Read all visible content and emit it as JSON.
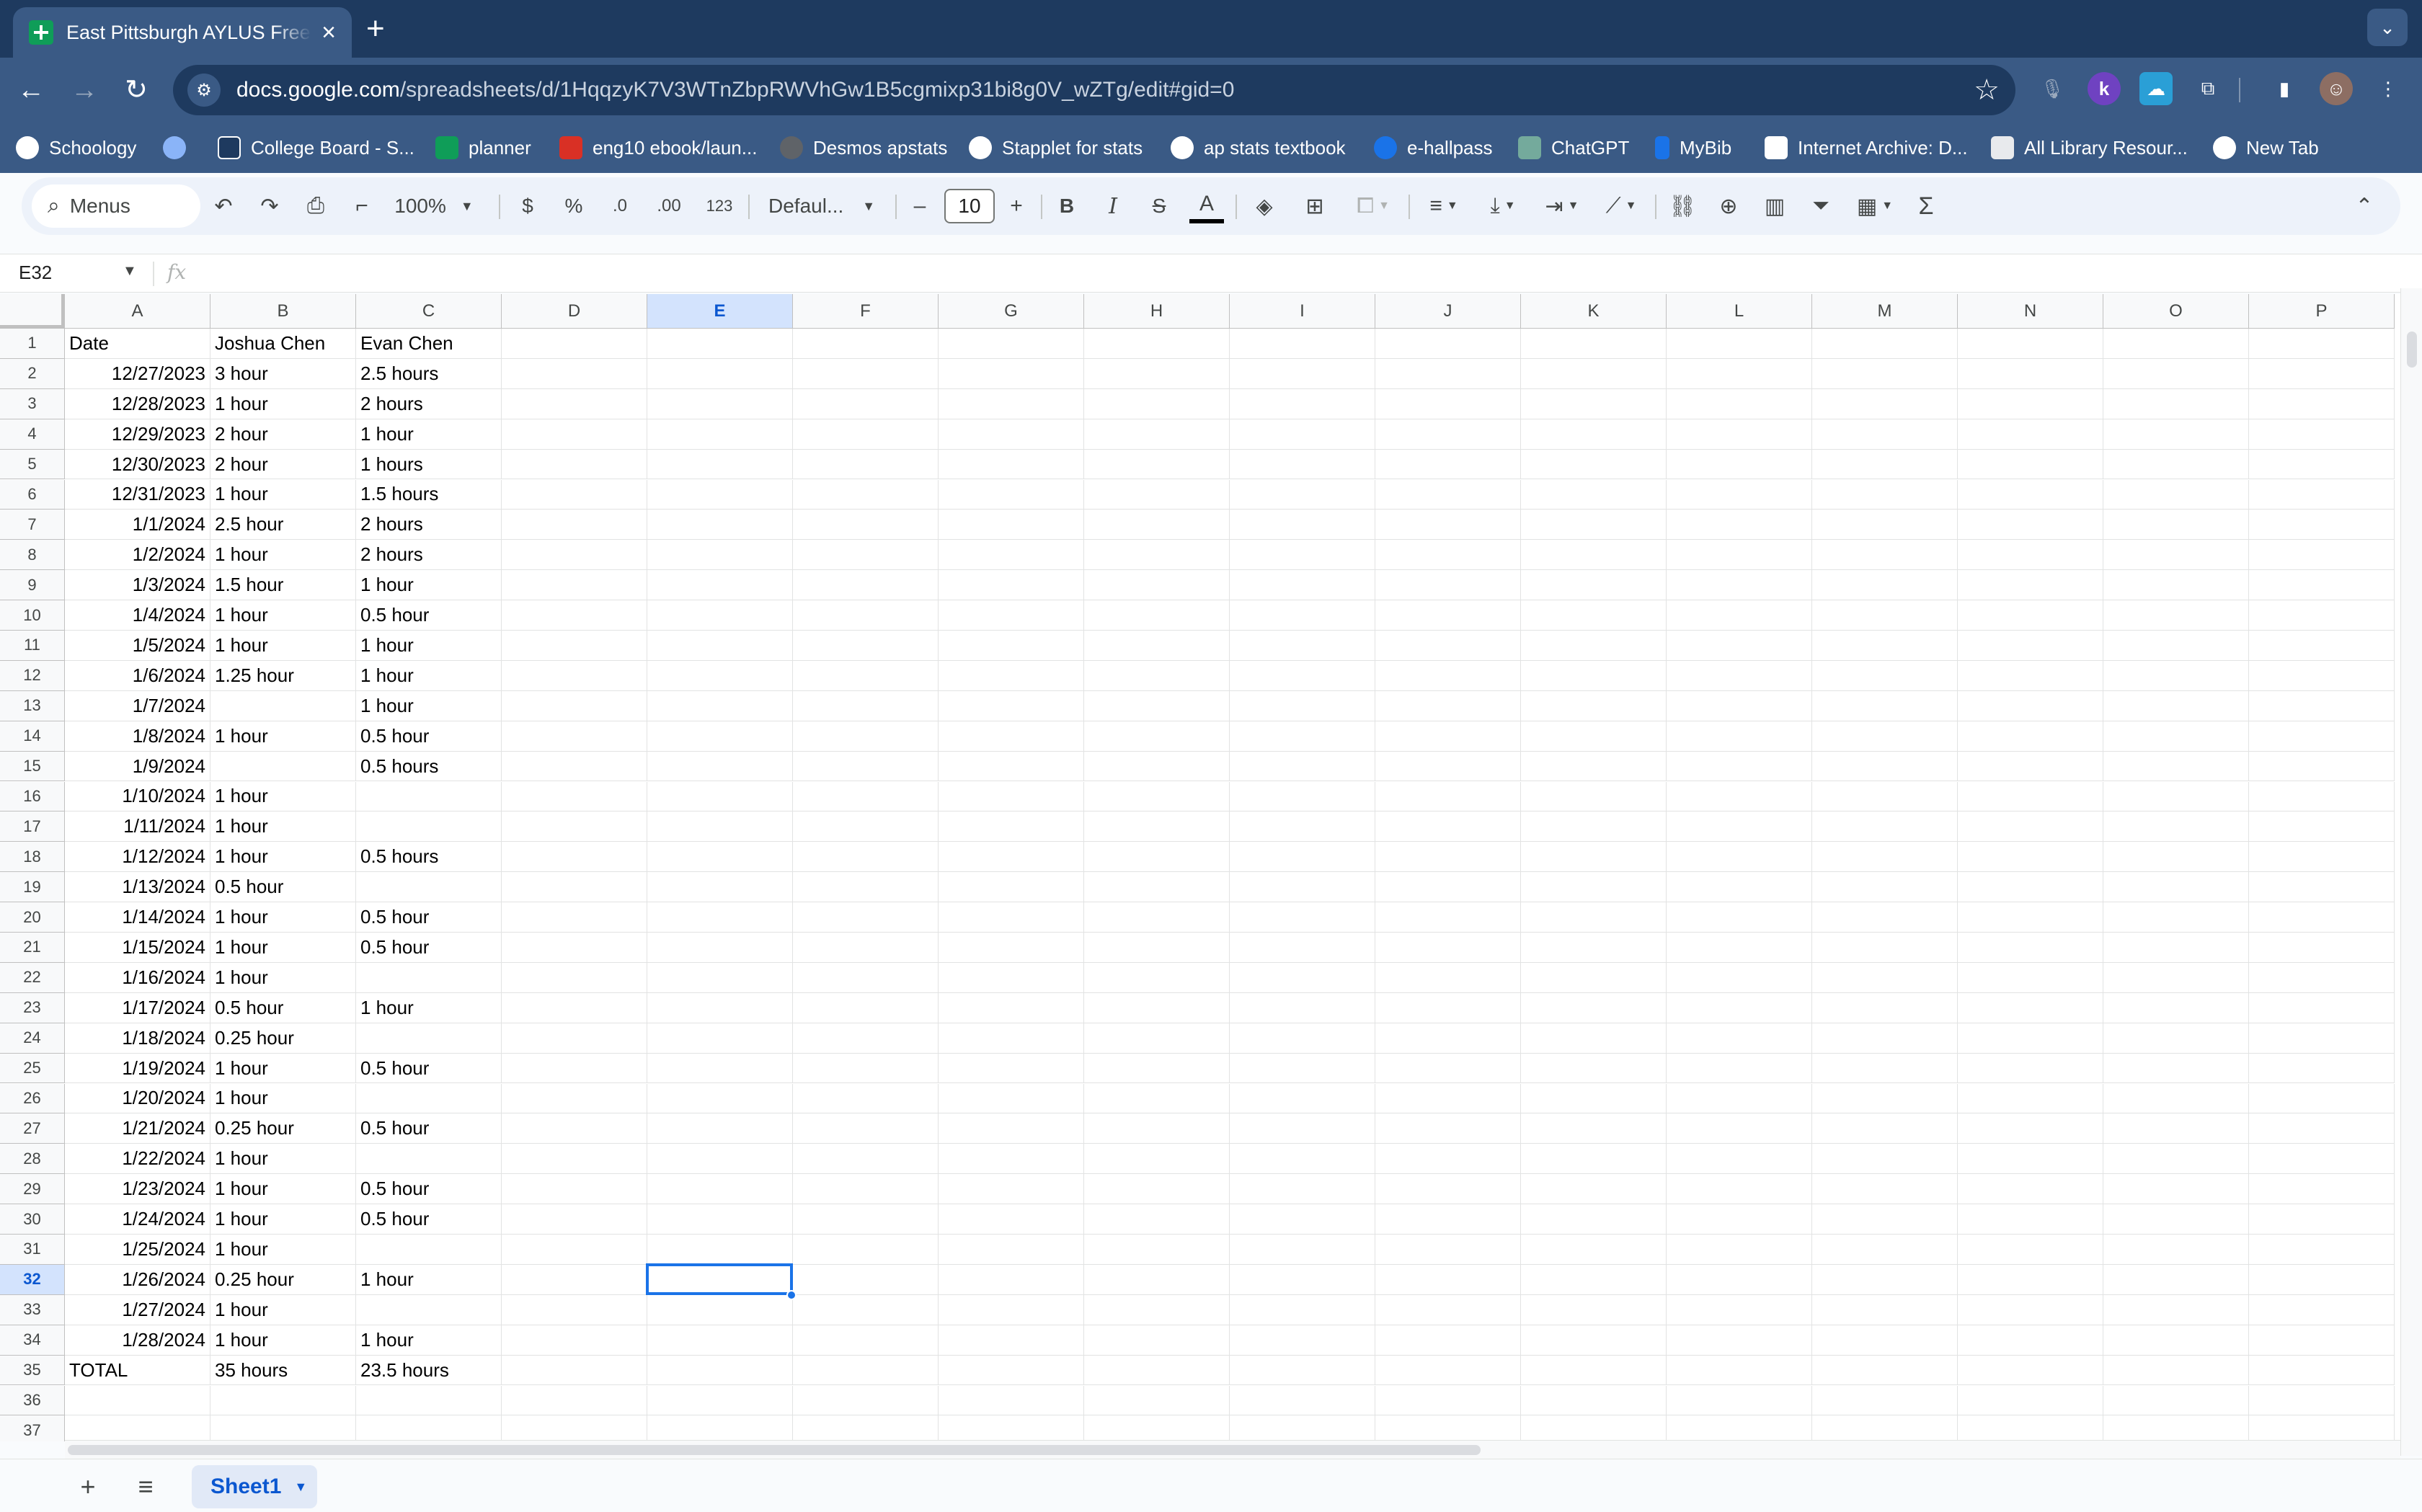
{
  "browser": {
    "tab_title": "East Pittsburgh AYLUS Freeride",
    "url_host": "docs.google.com",
    "url_path": "/spreadsheets/d/1HqqzyK7V3WTnZbpRWVhGw1B5cgmixp31bi8g0V_wZTg/edit#gid=0",
    "bookmarks": [
      {
        "label": "Schoology",
        "color": "#ffffff"
      },
      {
        "label": "",
        "color": "#8ab4f8"
      },
      {
        "label": "College Board - S...",
        "color": "#1e3a5f"
      },
      {
        "label": "planner",
        "color": "#0f9d58"
      },
      {
        "label": "eng10 ebook/laun...",
        "color": "#d93025"
      },
      {
        "label": "Desmos apstats",
        "color": "#5f6368"
      },
      {
        "label": "Stapplet for stats",
        "color": "#ffffff"
      },
      {
        "label": "ap stats textbook",
        "color": "#ffffff"
      },
      {
        "label": "e-hallpass",
        "color": "#1a73e8"
      },
      {
        "label": "ChatGPT",
        "color": "#74aa9c"
      },
      {
        "label": "MyBib",
        "color": "#1a73e8"
      },
      {
        "label": "Internet Archive: D...",
        "color": "#ffffff"
      },
      {
        "label": "All Library Resour...",
        "color": "#e8eaed"
      },
      {
        "label": "New Tab",
        "color": "#ffffff"
      }
    ]
  },
  "toolbar": {
    "menus_label": "Menus",
    "zoom": "100%",
    "currency": "$",
    "percent": "%",
    "dec_decrease": ".0",
    "dec_increase": ".00",
    "number_format": "123",
    "font": "Defaul...",
    "font_size": "10",
    "bold": "B",
    "italic": "I",
    "strike": "S",
    "text_color": "A",
    "minus": "–",
    "plus": "+"
  },
  "formula_bar": {
    "name_box": "E32",
    "fx": "fx"
  },
  "grid": {
    "columns": [
      "A",
      "B",
      "C",
      "D",
      "E",
      "F",
      "G",
      "H",
      "I",
      "J",
      "K",
      "L",
      "M",
      "N",
      "O",
      "P"
    ],
    "selected_column": "E",
    "selected_row": 32,
    "total_rows_shown": 37,
    "rows": [
      [
        "Date",
        "Joshua Chen",
        "Evan Chen"
      ],
      [
        "12/27/2023",
        "3 hour",
        "2.5 hours"
      ],
      [
        "12/28/2023",
        "1 hour",
        "2 hours"
      ],
      [
        "12/29/2023",
        "2 hour",
        "1 hour"
      ],
      [
        "12/30/2023",
        "2 hour",
        "1 hours"
      ],
      [
        "12/31/2023",
        "1 hour",
        "1.5 hours"
      ],
      [
        "1/1/2024",
        "2.5 hour",
        "2 hours"
      ],
      [
        "1/2/2024",
        "1 hour",
        "2 hours"
      ],
      [
        "1/3/2024",
        "1.5 hour",
        "1 hour"
      ],
      [
        "1/4/2024",
        "1 hour",
        "0.5 hour"
      ],
      [
        "1/5/2024",
        "1 hour",
        "1 hour"
      ],
      [
        "1/6/2024",
        "1.25 hour",
        "1 hour"
      ],
      [
        "1/7/2024",
        "",
        "1 hour"
      ],
      [
        "1/8/2024",
        "1 hour",
        "0.5 hour"
      ],
      [
        "1/9/2024",
        "",
        "0.5 hours"
      ],
      [
        "1/10/2024",
        "1 hour",
        ""
      ],
      [
        "1/11/2024",
        "1 hour",
        ""
      ],
      [
        "1/12/2024",
        "1 hour",
        "0.5 hours"
      ],
      [
        "1/13/2024",
        "0.5 hour",
        ""
      ],
      [
        "1/14/2024",
        "1 hour",
        "0.5 hour"
      ],
      [
        "1/15/2024",
        "1 hour",
        "0.5 hour"
      ],
      [
        "1/16/2024",
        "1 hour",
        ""
      ],
      [
        "1/17/2024",
        "0.5 hour",
        "1 hour"
      ],
      [
        "1/18/2024",
        "0.25 hour",
        ""
      ],
      [
        "1/19/2024",
        "1 hour",
        "0.5 hour"
      ],
      [
        "1/20/2024",
        "1 hour",
        ""
      ],
      [
        "1/21/2024",
        "0.25 hour",
        "0.5 hour"
      ],
      [
        "1/22/2024",
        "1 hour",
        ""
      ],
      [
        "1/23/2024",
        "1 hour",
        "0.5 hour"
      ],
      [
        "1/24/2024",
        "1 hour",
        "0.5 hour"
      ],
      [
        "1/25/2024",
        "1 hour",
        ""
      ],
      [
        "1/26/2024",
        "0.25 hour",
        "1 hour"
      ],
      [
        "1/27/2024",
        "1 hour",
        ""
      ],
      [
        "1/28/2024",
        "1 hour",
        "1 hour"
      ],
      [
        "TOTAL",
        "35 hours",
        "23.5 hours"
      ],
      [
        "",
        "",
        ""
      ],
      [
        "",
        "",
        ""
      ]
    ]
  },
  "sheets": {
    "tabs": [
      "Sheet1"
    ]
  }
}
